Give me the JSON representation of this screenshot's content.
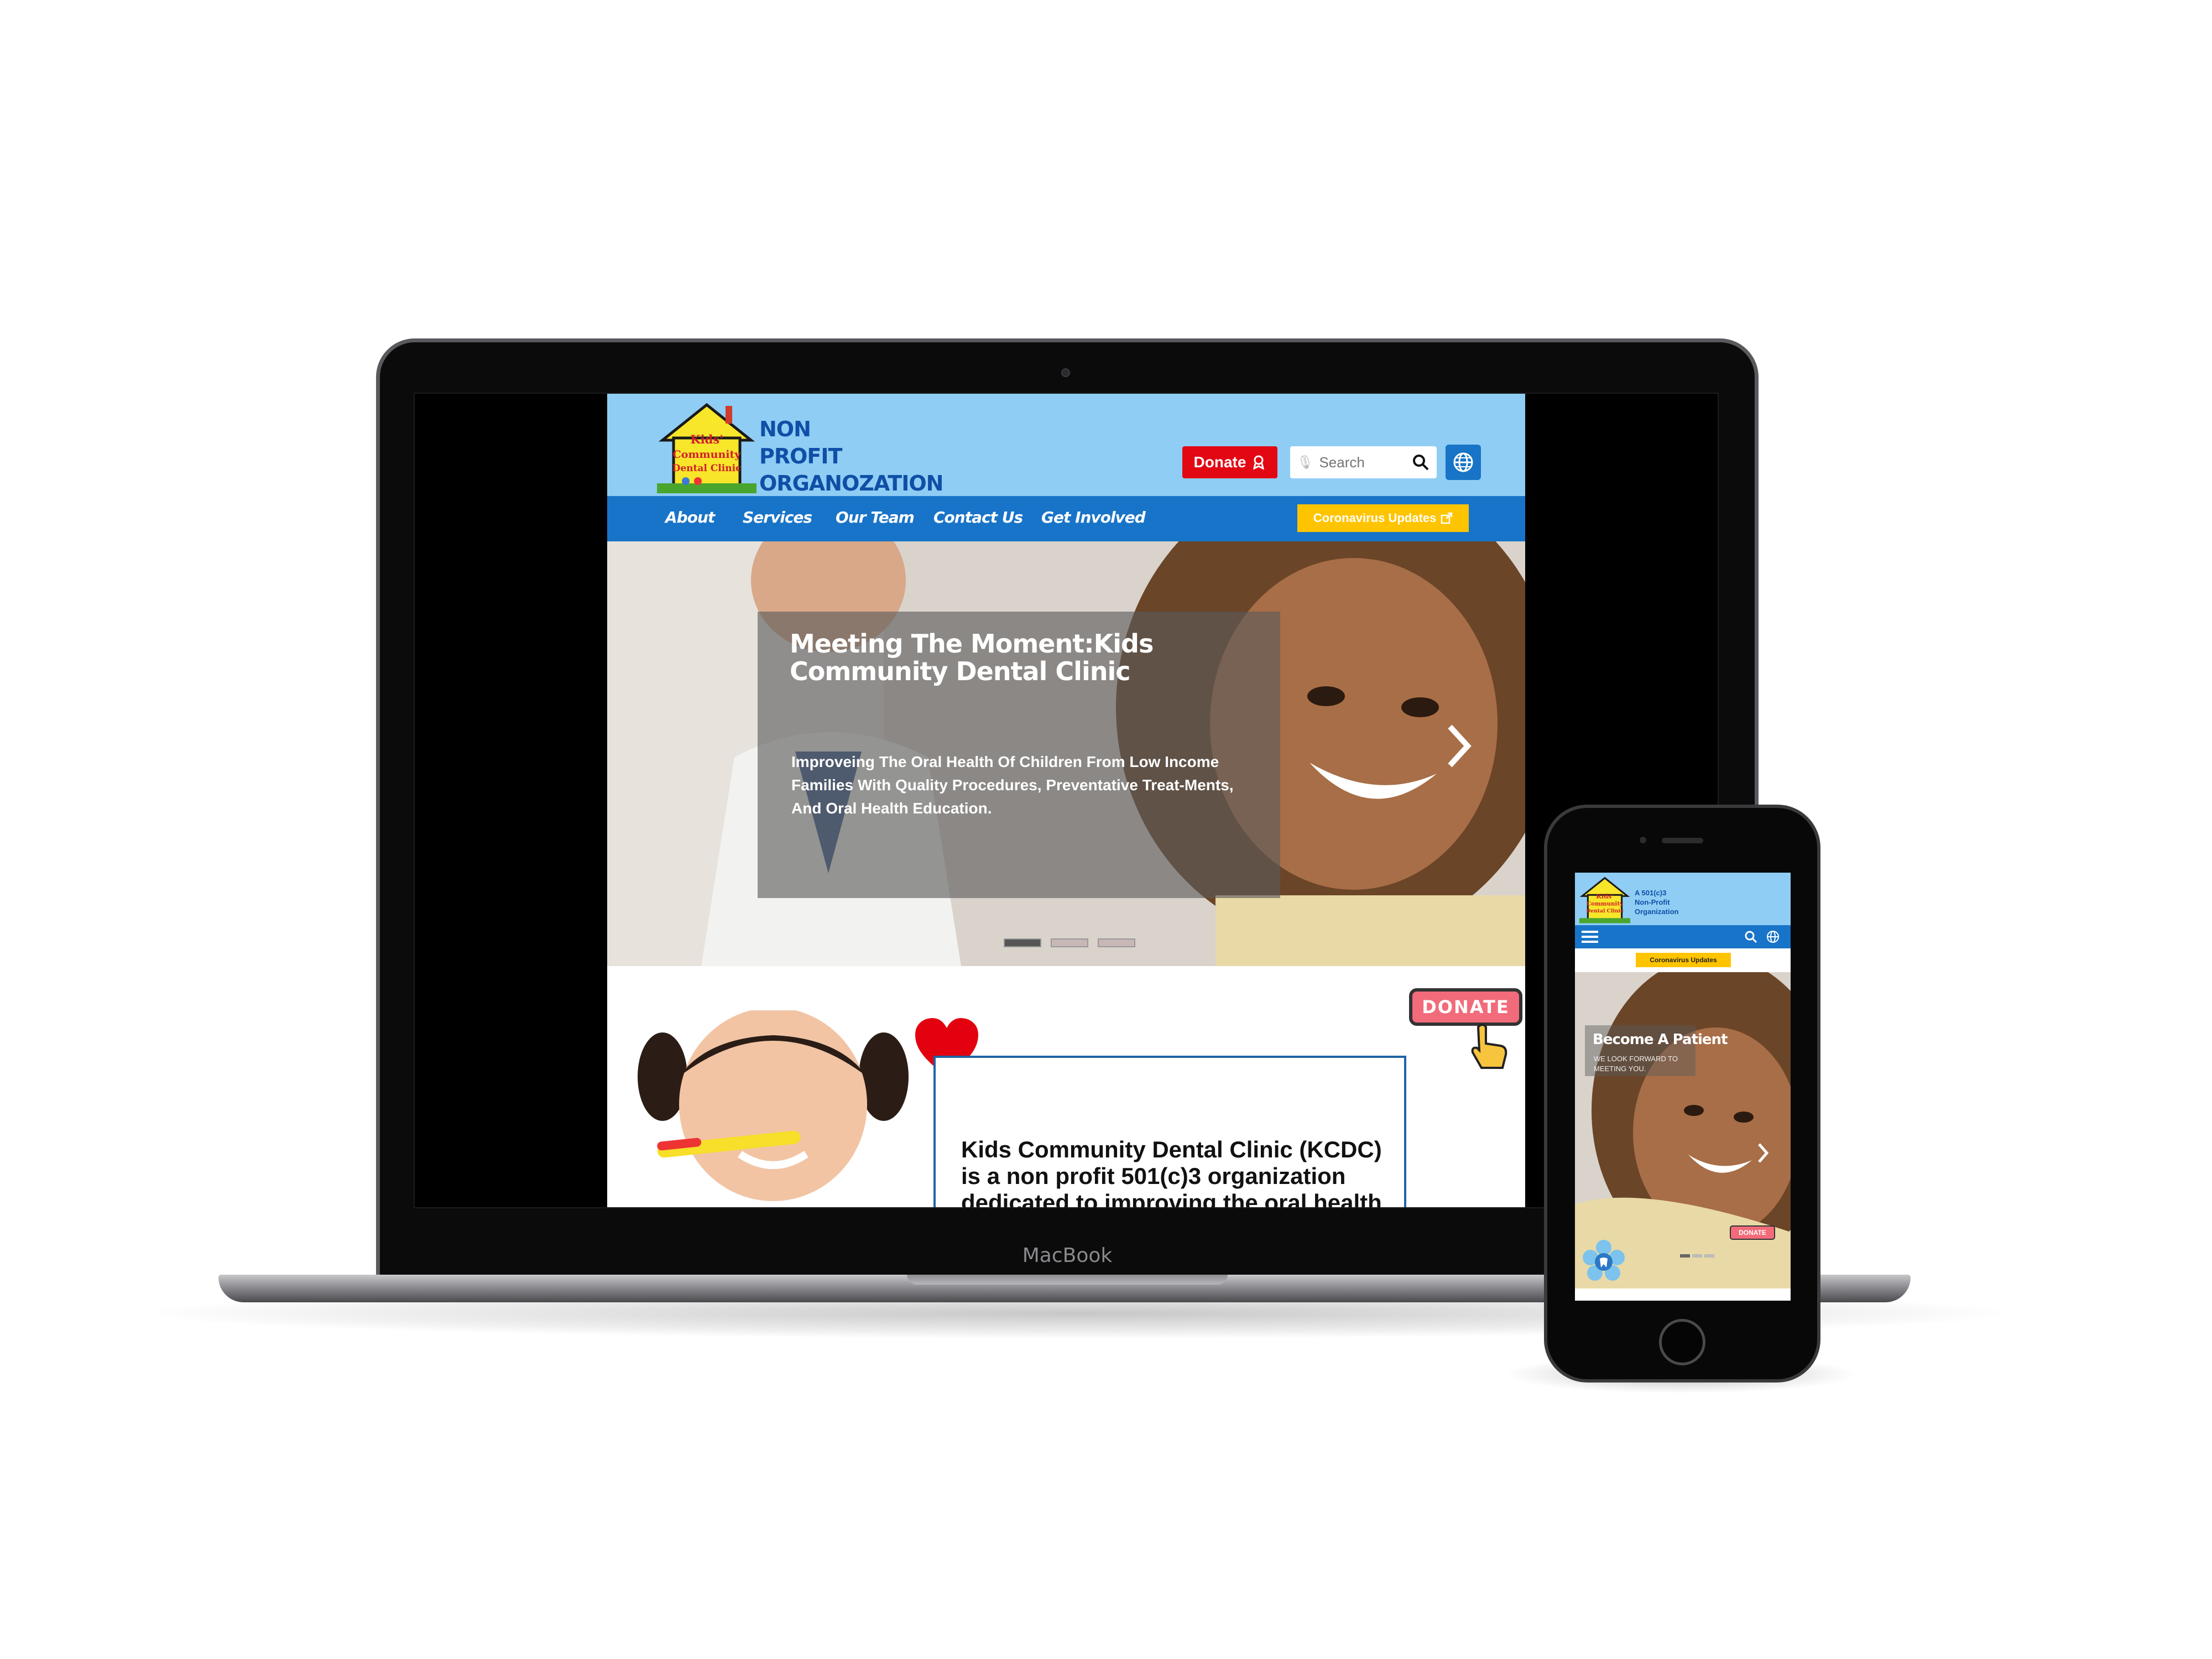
{
  "laptop": {
    "brand_label": "MacBook"
  },
  "site": {
    "logo_text": [
      "Kids'",
      "Community",
      "Dental Clinic"
    ],
    "org_title": [
      "NON",
      "PROFIT",
      "ORGANOZATION"
    ],
    "donate_label": "Donate",
    "search_placeholder": "Search",
    "nav": [
      {
        "label": "About"
      },
      {
        "label": "Services"
      },
      {
        "label": "Our Team"
      },
      {
        "label": "Contact Us"
      },
      {
        "label": "Get Involved"
      }
    ],
    "covid_label": "Coronavirus Updates",
    "hero": {
      "title": "Meeting The Moment:Kids Community Dental Clinic",
      "text": "Improveing  The Oral Health Of Children From Low Income Families With Quality Procedures, Preventative Treat-Ments, And Oral Health Education.",
      "slide_count": 3,
      "active_slide": 1
    },
    "kcdc_text": "Kids Community Dental Clinic (KCDC) is a non profit 501(c)3 organization dedicated to improving the oral health",
    "donate_sticker": "DONATE",
    "colors": {
      "header_bg": "#8fcdf5",
      "nav_bg": "#1874c8",
      "donate_red": "#e30613",
      "covid_yellow": "#ffc400",
      "title_blue": "#0f4fa6"
    }
  },
  "phone": {
    "tagline": [
      "A 501(c)3",
      "Non-Profit",
      "Organization"
    ],
    "covid_label": "Coronavirus Updates",
    "hero_title": "Become A Patient",
    "hero_text": "WE LOOK FORWARD TO MEETING YOU.",
    "donate_label": "DONATE",
    "icons": [
      "menu-icon",
      "search-icon",
      "globe-icon",
      "chevron-right-icon"
    ]
  }
}
